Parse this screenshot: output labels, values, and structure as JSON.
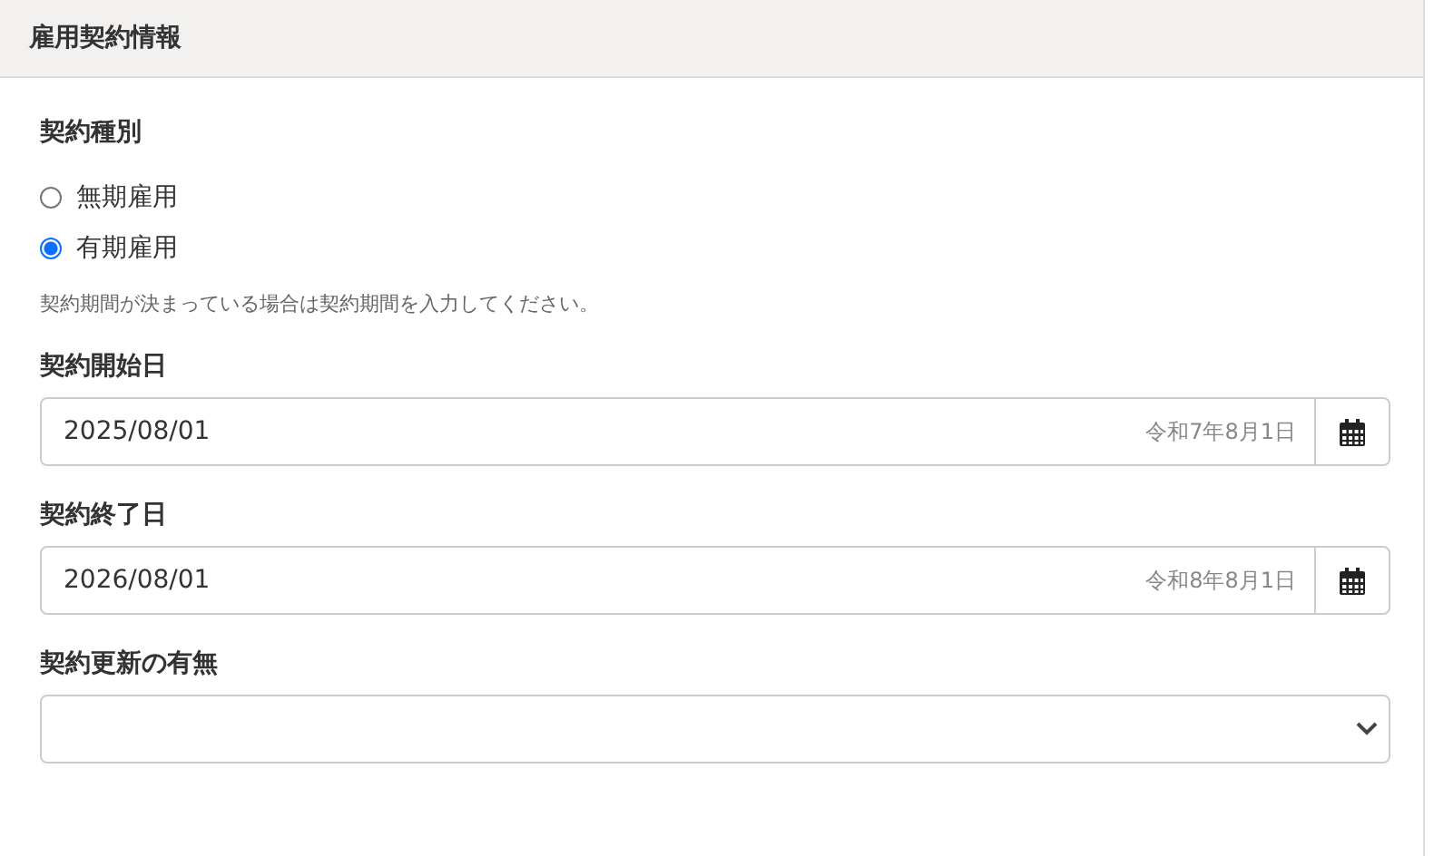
{
  "section": {
    "title": "雇用契約情報"
  },
  "contract_type": {
    "label": "契約種別",
    "options": [
      {
        "label": "無期雇用",
        "selected": false
      },
      {
        "label": "有期雇用",
        "selected": true
      }
    ],
    "hint": "契約期間が決まっている場合は契約期間を入力してください。"
  },
  "date_fields": [
    {
      "label": "契約開始日",
      "value": "2025/08/01",
      "era_date": "令和7年8月1日"
    },
    {
      "label": "契約終了日",
      "value": "2026/08/01",
      "era_date": "令和8年8月1日"
    }
  ],
  "renewal": {
    "label": "契約更新の有無"
  }
}
